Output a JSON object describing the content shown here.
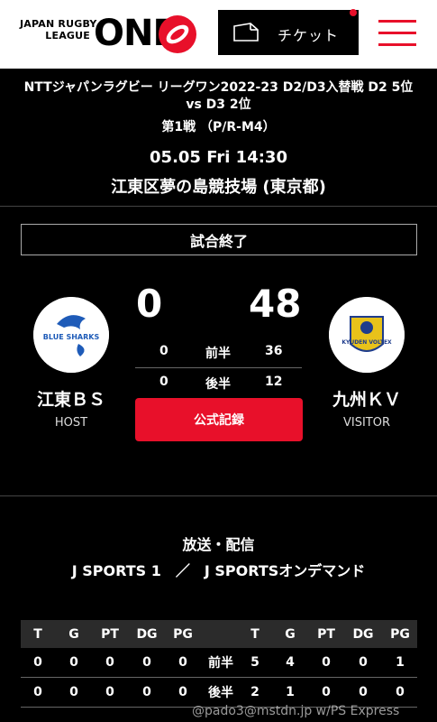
{
  "header": {
    "logo_line1": "JAPAN RUGBY",
    "logo_line2": "LEAGUE",
    "logo_one": "ONE",
    "ticket_label": "チケット"
  },
  "match": {
    "title": "NTTジャパンラグビー リーグワン2022-23 D2/D3入替戦 D2 5位 vs D3 2位",
    "subtitle": "第1戦 （P/R-M4）",
    "datetime": "05.05  Fri 14:30",
    "venue": "江東区夢の島競技場 (東京都)",
    "status": "試合終了"
  },
  "home": {
    "name": "江東ＢＳ",
    "role": "HOST",
    "score": "0",
    "first_half": "0",
    "second_half": "0",
    "logo_text": "BLUE SHARKS"
  },
  "away": {
    "name": "九州ＫＶ",
    "role": "VISITOR",
    "score": "48",
    "first_half": "36",
    "second_half": "12",
    "logo_text": "KYUDEN VOLTEX"
  },
  "halves": {
    "first": "前半",
    "second": "後半"
  },
  "record_button": "公式記録",
  "broadcast": {
    "title": "放送・配信",
    "channels": "J SPORTS 1　／　J SPORTSオンデマンド"
  },
  "stats": {
    "headers": [
      "T",
      "G",
      "PT",
      "DG",
      "PG"
    ],
    "rows": [
      {
        "label": "前半",
        "home": [
          "0",
          "0",
          "0",
          "0",
          "0"
        ],
        "away": [
          "5",
          "4",
          "0",
          "0",
          "1"
        ]
      },
      {
        "label": "後半",
        "home": [
          "0",
          "0",
          "0",
          "0",
          "0"
        ],
        "away": [
          "2",
          "1",
          "0",
          "0",
          "0"
        ]
      }
    ]
  },
  "watermark": "@pado3@mstdn.jp w/PS Express",
  "colors": {
    "accent": "#e8102a",
    "home_blue": "#1e5bb8",
    "away_yellow": "#e8c21a"
  }
}
